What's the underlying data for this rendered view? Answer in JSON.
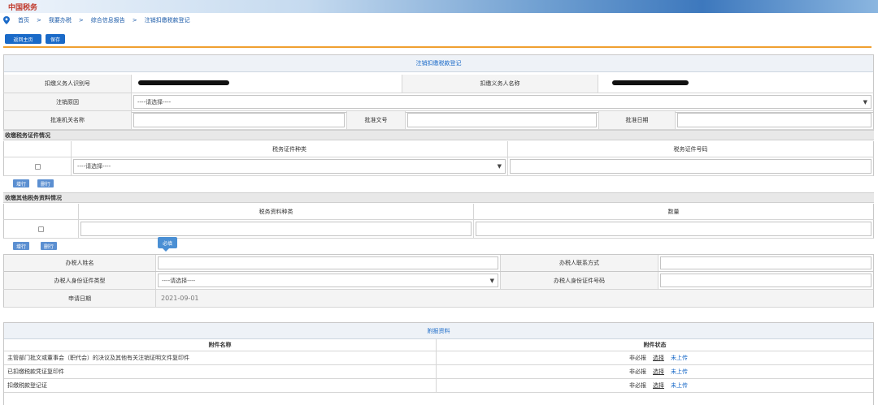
{
  "header": {
    "logo": "中国税务"
  },
  "breadcrumb": {
    "items": [
      "首页",
      "我要办税",
      "综合信息报告",
      "注销扣缴税款登记"
    ],
    "sep": ">"
  },
  "toolbar": {
    "btn_back": "返回主页",
    "btn_save": "保存"
  },
  "form": {
    "title": "注销扣缴税款登记",
    "row1": {
      "label_id": "扣缴义务人识别号",
      "label_name": "扣缴义务人名称"
    },
    "row2": {
      "label": "注销原因",
      "select": "----请选择----"
    },
    "row3": {
      "label_org": "批准机关名称",
      "label_doc": "批准文号",
      "label_date": "批准日期"
    }
  },
  "cert": {
    "section": "收缴税务证件情况",
    "col_type": "税务证件种类",
    "col_no": "税务证件号码",
    "select": "----请选择----",
    "add": "增行",
    "del": "删行"
  },
  "other": {
    "section": "收缴其他税务资料情况",
    "col_type": "税务资料种类",
    "col_qty": "数量",
    "add": "增行",
    "del": "删行",
    "tooltip": "必填"
  },
  "handler": {
    "label_name": "办税人姓名",
    "label_contact": "办税人联系方式",
    "label_idtype": "办税人身份证件类型",
    "idtype_select": "----请选择----",
    "label_idno": "办税人身份证件号码",
    "label_apply": "申请日期",
    "apply_date": "2021-09-01"
  },
  "attachments": {
    "title": "附报资料",
    "col_name": "附件名称",
    "col_status": "附件状态",
    "rows": [
      {
        "name": "主管部门批文或董事会（职代会）的决议及其他有关注销证明文件复印件",
        "req": "非必报",
        "choose": "选择",
        "state": "未上传"
      },
      {
        "name": "已扣缴税款凭证复印件",
        "req": "非必报",
        "choose": "选择",
        "state": "未上传"
      },
      {
        "name": "扣缴税款登记证",
        "req": "非必报",
        "choose": "选择",
        "state": "未上传"
      }
    ]
  },
  "colors": {
    "accent": "#1a6ac8",
    "orange_rule": "#f0a030",
    "tooltip": "#4a8fd4"
  }
}
